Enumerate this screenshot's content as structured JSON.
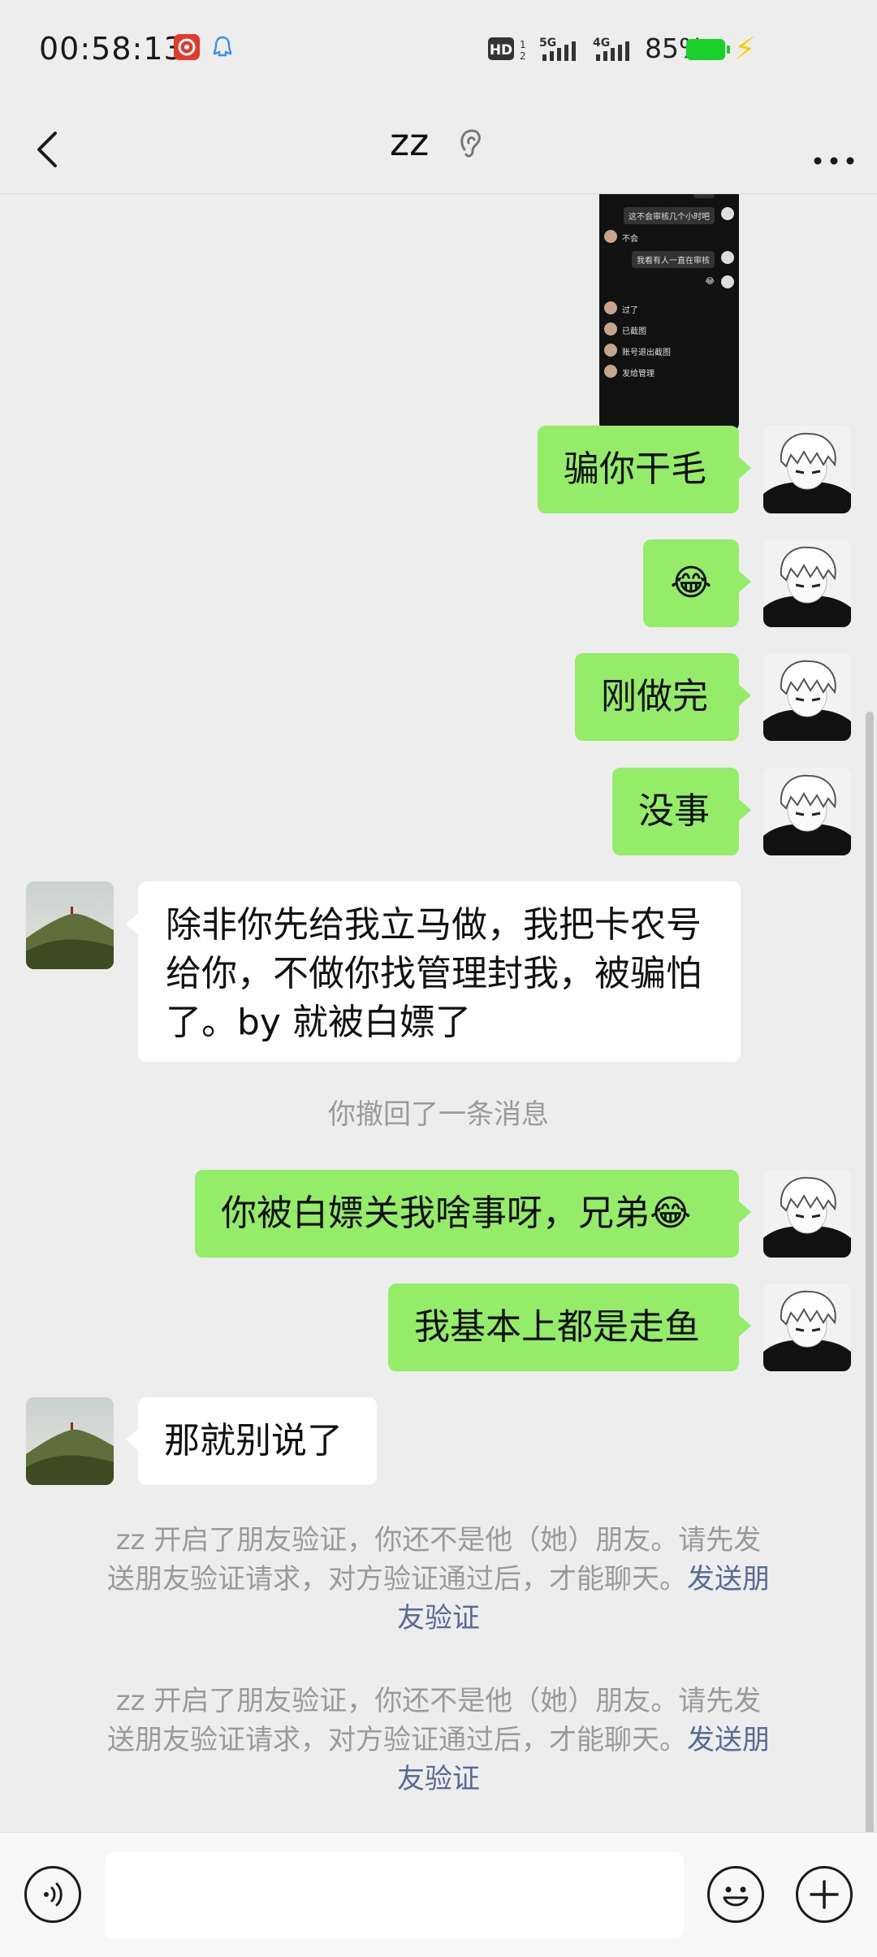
{
  "status_bar": {
    "time": "00:58:13",
    "network": "HD 5G 4G",
    "battery": "85%"
  },
  "header": {
    "title": "zz"
  },
  "thumbnail": {
    "lines": [
      "这不会审核几个小时吧",
      "不会",
      "我看有人一直在审核",
      "过了",
      "已截图",
      "账号退出截图",
      "发给管理"
    ],
    "top_label": "OK"
  },
  "messages": [
    {
      "from": "me",
      "text": "骗你干毛"
    },
    {
      "from": "me",
      "text": "😂"
    },
    {
      "from": "me",
      "text": "刚做完"
    },
    {
      "from": "me",
      "text": "没事"
    },
    {
      "from": "them",
      "line1": "除非你先给我立马做，我把卡农号",
      "line2": "给你，不做你找管理封我，被骗怕",
      "line3": "了。by 就被白嫖了"
    },
    {
      "from": "system",
      "text": "你撤回了一条消息"
    },
    {
      "from": "me",
      "text": "你被白嫖关我啥事呀，兄弟😂"
    },
    {
      "from": "me",
      "text": "我基本上都是走鱼"
    },
    {
      "from": "them",
      "text": "那就别说了"
    }
  ],
  "verification": {
    "line1": "zz 开启了朋友验证，你还不是他（她）朋友。请先发",
    "line2": "送朋友验证请求，对方验证通过后，才能聊天。",
    "link_a": "发送朋",
    "link_b": "友验证"
  },
  "colors": {
    "my_bubble": "#95ec69",
    "their_bubble": "#ffffff",
    "background": "#ededed",
    "link": "#576b95"
  }
}
